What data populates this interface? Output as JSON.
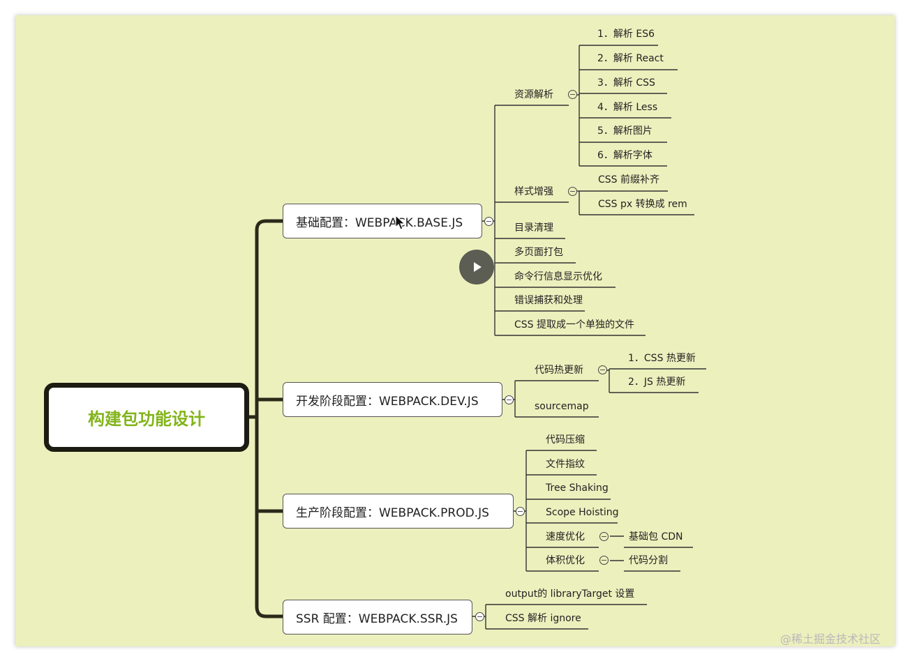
{
  "root": {
    "label": "构建包功能设计"
  },
  "branches": {
    "base": {
      "label": "基础配置：WEBPACK.BASE.JS",
      "resource_parsing": {
        "label": "资源解析",
        "items": [
          "1．解析 ES6",
          "2．解析 React",
          "3．解析 CSS",
          "4．解析 Less",
          "5．解析图片",
          "6．解析字体"
        ]
      },
      "style_enhance": {
        "label": "样式增强",
        "items": [
          "CSS 前缀补齐",
          "CSS px 转换成 rem"
        ]
      },
      "items": [
        "目录清理",
        "多页面打包",
        "命令行信息显示优化",
        "错误捕获和处理",
        "CSS 提取成一个单独的文件"
      ]
    },
    "dev": {
      "label": "开发阶段配置：WEBPACK.DEV.JS",
      "hmr": {
        "label": "代码热更新",
        "items": [
          "1．CSS 热更新",
          "2．JS 热更新"
        ]
      },
      "sourcemap": "sourcemap"
    },
    "prod": {
      "label": "生产阶段配置：WEBPACK.PROD.JS",
      "items": [
        "代码压缩",
        "文件指纹",
        "Tree Shaking",
        "Scope Hoisting"
      ],
      "speed": {
        "label": "速度优化",
        "child": "基础包 CDN"
      },
      "size": {
        "label": "体积优化",
        "child": "代码分割"
      }
    },
    "ssr": {
      "label": "SSR 配置：WEBPACK.SSR.JS",
      "items": [
        "output的 libraryTarget 设置",
        "CSS 解析 ignore"
      ]
    }
  },
  "collapse_symbol": "−",
  "watermark": "@稀土掘金技术社区",
  "colors": {
    "background": "#ecf0bd",
    "root_text": "#82b41a",
    "line": "#1c1c12",
    "watermark": "#b9b9b9"
  },
  "icons": [
    "play-icon",
    "mouse-cursor-icon",
    "collapse-icon"
  ]
}
